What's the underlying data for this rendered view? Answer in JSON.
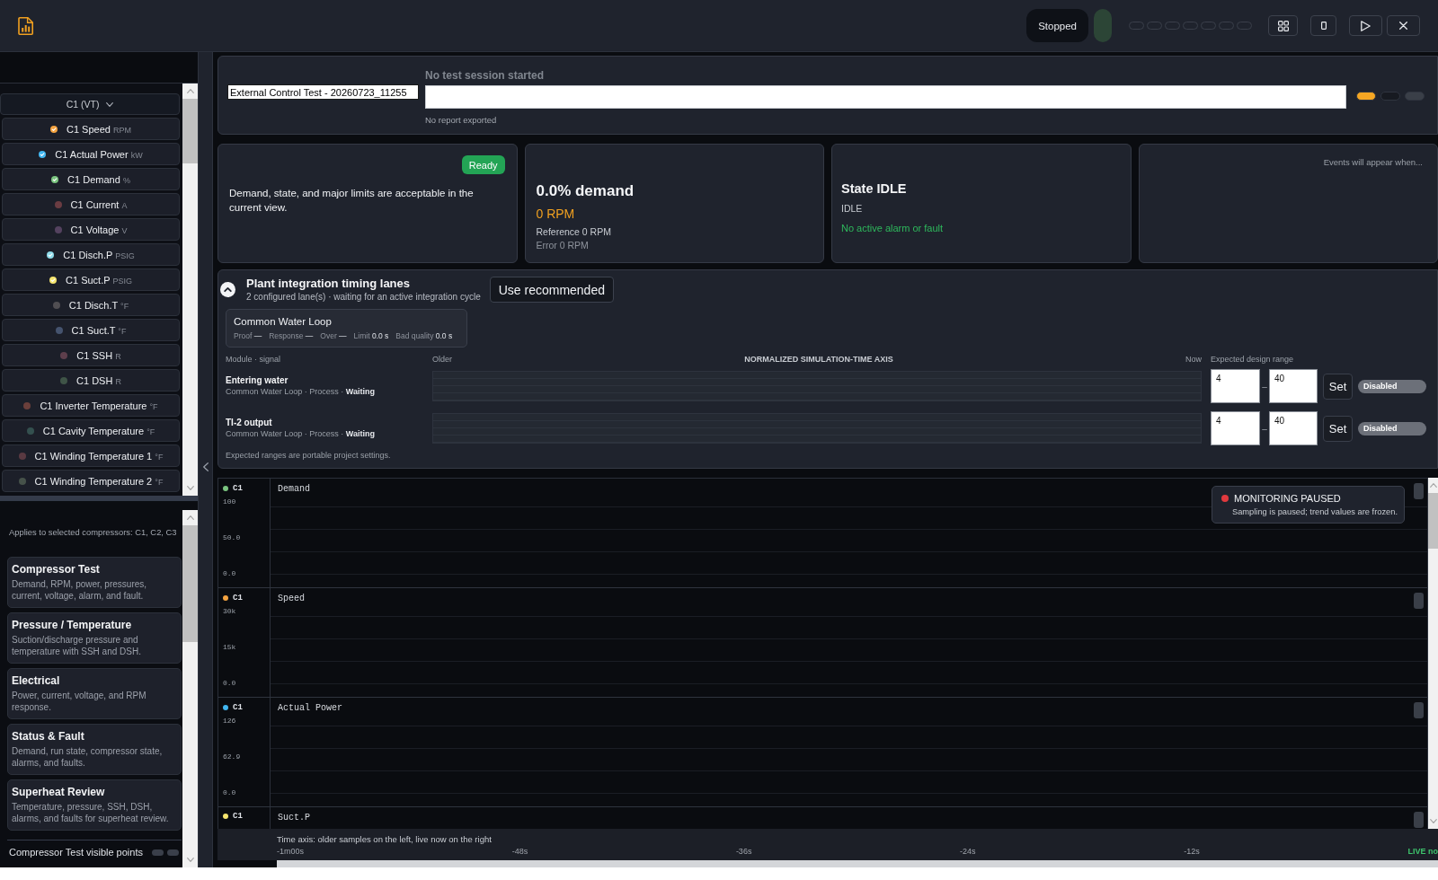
{
  "toolbar": {
    "status": "Stopped",
    "run_indicator": {
      "on": false
    },
    "indicators": [
      {
        "on": false
      },
      {
        "on": false
      },
      {
        "on": false
      },
      {
        "on": false
      },
      {
        "on": false
      },
      {
        "on": false
      },
      {
        "on": false
      }
    ],
    "buttons": [
      {
        "kind": "grid"
      },
      {
        "kind": "panel"
      },
      {
        "kind": "play"
      },
      {
        "kind": "close"
      }
    ]
  },
  "channel_picker": {
    "label": "C1 (VT)",
    "expanded": false
  },
  "channels": [
    {
      "name": "C1 Speed",
      "unit": "RPM",
      "color": "#f4a340",
      "selected": true
    },
    {
      "name": "C1 Actual Power",
      "unit": "kW",
      "color": "#41b6f0",
      "selected": true
    },
    {
      "name": "C1 Demand",
      "unit": "%",
      "color": "#7ac47f",
      "selected": true
    },
    {
      "name": "C1 Current",
      "unit": "A",
      "color": "#6a3c42",
      "selected": false
    },
    {
      "name": "C1 Voltage",
      "unit": "V",
      "color": "#54425f",
      "selected": false
    },
    {
      "name": "C1 Disch.P",
      "unit": "PSIG",
      "color": "#8fdcea",
      "selected": true
    },
    {
      "name": "C1 Suct.P",
      "unit": "PSIG",
      "color": "#f5e46e",
      "selected": true
    },
    {
      "name": "C1 Disch.T",
      "unit": "°F",
      "color": "#504e52",
      "selected": false
    },
    {
      "name": "C1 Suct.T",
      "unit": "°F",
      "color": "#45536e",
      "selected": false
    },
    {
      "name": "C1 SSH",
      "unit": "R",
      "color": "#5e3f4c",
      "selected": false
    },
    {
      "name": "C1 DSH",
      "unit": "R",
      "color": "#3f5447",
      "selected": false
    },
    {
      "name": "C1 Inverter Temperature",
      "unit": "°F",
      "color": "#6b3f3b",
      "selected": false
    },
    {
      "name": "C1 Cavity Temperature",
      "unit": "°F",
      "color": "#34504f",
      "selected": false
    },
    {
      "name": "C1 Winding Temperature 1",
      "unit": "°F",
      "color": "#5a3a42",
      "selected": false
    },
    {
      "name": "C1 Winding Temperature 2",
      "unit": "°F",
      "color": "#46524a",
      "selected": false
    }
  ],
  "presets": {
    "note": "Applies to selected compressors: C1, C2, C3",
    "items": [
      {
        "title": "Compressor Test",
        "description": "Demand, RPM, power, pressures, current, voltage, alarm, and fault."
      },
      {
        "title": "Pressure / Temperature",
        "description": "Suction/discharge pressure and temperature with SSH and DSH."
      },
      {
        "title": "Electrical",
        "description": "Power, current, voltage, and RPM response."
      },
      {
        "title": "Status & Fault",
        "description": "Demand, run state, compressor state, alarms, and faults."
      },
      {
        "title": "Superheat Review",
        "description": "Temperature, pressure, SSH, DSH, alarms, and faults for superheat review."
      }
    ],
    "visible_points": {
      "label": "Compressor Test visible points",
      "toggles": [
        {
          "on": false
        },
        {
          "on": false
        }
      ]
    }
  },
  "session": {
    "name": "External Control Test - 20260723_11255",
    "status": "No test session started",
    "report": "No report exported",
    "markers": [
      {
        "color": "#f5a623"
      },
      {
        "color": "#171a21"
      },
      {
        "color": "#3a3f48"
      }
    ]
  },
  "summary_cards": [
    {
      "kind": "health",
      "badge": "Ready",
      "text": "Demand, state, and major limits are acceptable in the current view."
    },
    {
      "kind": "demand",
      "headline": "0.0% demand",
      "speed": "0 RPM",
      "reference": "Reference 0 RPM",
      "error": "Error 0 RPM"
    },
    {
      "kind": "state",
      "headline": "State IDLE",
      "state": "IDLE",
      "alarm": "No active alarm or fault"
    },
    {
      "kind": "events",
      "text": "Events will appear when..."
    }
  ],
  "timing_lanes": {
    "expanded": true,
    "title": "Plant integration timing lanes",
    "subtitle": "2 configured lane(s) · waiting for an active integration cycle",
    "action": "Use recommended",
    "loop": {
      "name": "Common Water Loop",
      "metrics": [
        "Proof **—**",
        "Response **—**",
        "Over **—**",
        "Limit **0.0 s**",
        "Bad quality **0.0 s**"
      ]
    },
    "columns": {
      "signal": "Module · signal",
      "older": "Older",
      "axis": "NORMALIZED SIMULATION-TIME AXIS",
      "now": "Now",
      "range": "Expected design range"
    },
    "lanes": [
      {
        "name": "Entering water",
        "context": "Common Water Loop · Process · **Waiting**",
        "min": "4",
        "separator": "–",
        "max": "40",
        "set": "Set",
        "enabled": false,
        "toggle": "Disabled"
      },
      {
        "name": "TI-2 output",
        "context": "Common Water Loop · Process · **Waiting**",
        "min": "4",
        "separator": "–",
        "max": "40",
        "set": "Set",
        "enabled": false,
        "toggle": "Disabled"
      }
    ],
    "footnote": "Expected ranges are portable project settings."
  },
  "trends": {
    "strips": [
      {
        "channel": "C1",
        "color": "#7ac47f",
        "title": "Demand",
        "ticks": [
          "100",
          "50.0",
          "0.0"
        ]
      },
      {
        "channel": "C1",
        "color": "#f4a340",
        "title": "Speed",
        "ticks": [
          "30k",
          "15k",
          "0.0"
        ]
      },
      {
        "channel": "C1",
        "color": "#41b6f0",
        "title": "Actual Power",
        "ticks": [
          "126",
          "62.9",
          "0.0"
        ]
      },
      {
        "channel": "C1",
        "color": "#f5e46e",
        "title": "Suct.P"
      }
    ],
    "monitoring": {
      "paused": true,
      "title": "MONITORING PAUSED",
      "text": "Sampling is paused; trend values are frozen."
    },
    "time_axis": {
      "note": "Time axis: older samples on the left, live now on the right",
      "ticks": [
        "-1m00s",
        "-48s",
        "-36s",
        "-24s",
        "-12s"
      ],
      "live": "LIVE no"
    }
  }
}
